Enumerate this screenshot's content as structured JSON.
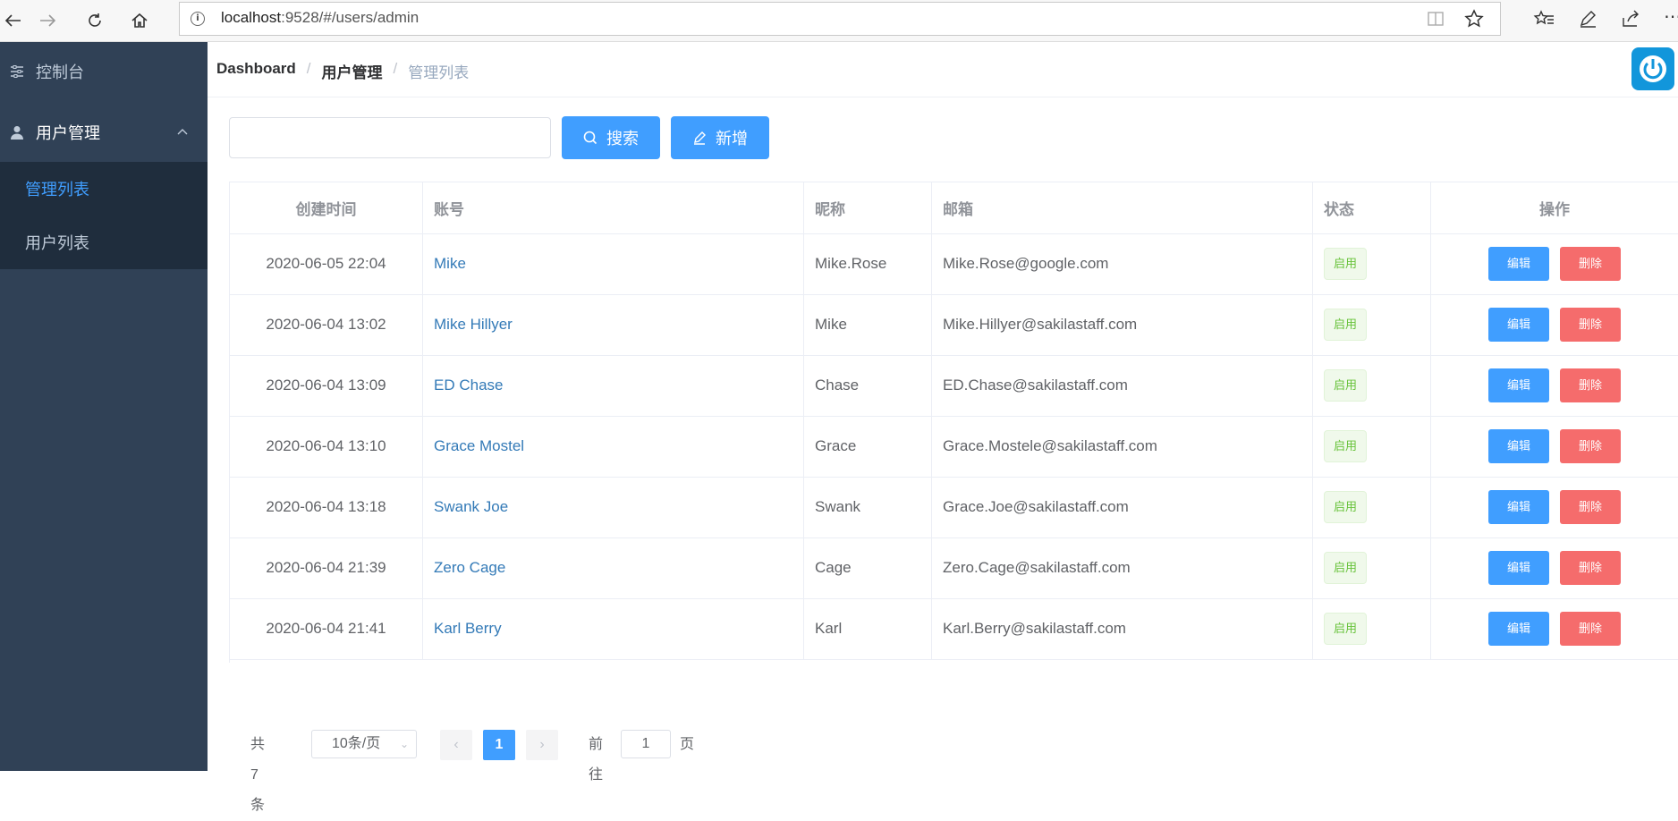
{
  "browser": {
    "url_host": "localhost",
    "url_path": ":9528/#/users/admin"
  },
  "sidebar": {
    "items": [
      {
        "label": "控制台",
        "icon": "sliders-icon"
      },
      {
        "label": "用户管理",
        "icon": "user-icon",
        "expanded": true
      }
    ],
    "subitems": [
      {
        "label": "管理列表",
        "active": true
      },
      {
        "label": "用户列表",
        "active": false
      }
    ]
  },
  "breadcrumb": {
    "items": [
      "Dashboard",
      "用户管理",
      "管理列表"
    ],
    "separator": "/"
  },
  "toolbar": {
    "search_value": "",
    "search_button": "搜索",
    "add_button": "新增"
  },
  "table": {
    "headers": [
      "创建时间",
      "账号",
      "昵称",
      "邮箱",
      "状态",
      "操作"
    ],
    "rows": [
      {
        "created": "2020-06-05 22:04",
        "account": "Mike",
        "nickname": "Mike.Rose",
        "email": "Mike.Rose@google.com",
        "status": "启用"
      },
      {
        "created": "2020-06-04 13:02",
        "account": "Mike Hillyer",
        "nickname": "Mike",
        "email": "Mike.Hillyer@sakilastaff.com",
        "status": "启用"
      },
      {
        "created": "2020-06-04 13:09",
        "account": "ED Chase",
        "nickname": "Chase",
        "email": "ED.Chase@sakilastaff.com",
        "status": "启用"
      },
      {
        "created": "2020-06-04 13:10",
        "account": "Grace Mostel",
        "nickname": "Grace",
        "email": "Grace.Mostele@sakilastaff.com",
        "status": "启用"
      },
      {
        "created": "2020-06-04 13:18",
        "account": "Swank Joe",
        "nickname": "Swank",
        "email": "Grace.Joe@sakilastaff.com",
        "status": "启用"
      },
      {
        "created": "2020-06-04 21:39",
        "account": "Zero Cage",
        "nickname": "Cage",
        "email": "Zero.Cage@sakilastaff.com",
        "status": "启用"
      },
      {
        "created": "2020-06-04 21:41",
        "account": "Karl Berry",
        "nickname": "Karl",
        "email": "Karl.Berry@sakilastaff.com",
        "status": "启用"
      }
    ],
    "edit_label": "编辑",
    "delete_label": "删除"
  },
  "pagination": {
    "total_text": "共 7 条",
    "page_size": "10条/页",
    "current_page": "1",
    "goto_label": "前往",
    "goto_value": "1",
    "page_suffix": "页"
  },
  "colors": {
    "sidebar_bg": "#304156",
    "submenu_bg": "#1f2d3d",
    "primary": "#409eff",
    "danger": "#f56c6c",
    "success": "#67c23a",
    "link": "#337ab7"
  }
}
